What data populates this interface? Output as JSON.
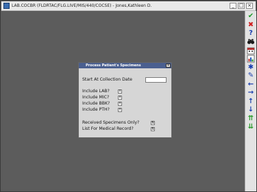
{
  "window": {
    "title": "LAB.COCBR (FLDRTAC/FLG.LIVE/MIS/440/COCSE) - Jones,Kathleen D.",
    "minimize_glyph": "_",
    "maximize_glyph": "□",
    "close_glyph": "×"
  },
  "toolbar": {
    "items": [
      {
        "name": "ok-check-icon",
        "glyph": "✔",
        "color": "#1e9a28"
      },
      {
        "name": "cancel-x-icon",
        "glyph": "✖",
        "color": "#d02020"
      },
      {
        "name": "help-question-icon",
        "glyph": "?",
        "color": "#1a3fb0"
      },
      {
        "name": "binoculars-icon",
        "glyph": "",
        "color": "#1a1a1a"
      },
      {
        "name": "calendar-icon",
        "glyph": "",
        "color": "#b03030"
      },
      {
        "name": "report-chart-icon",
        "glyph": "",
        "color": "#c03030"
      },
      {
        "name": "star-icon",
        "glyph": "✱",
        "color": "#1a3fb0"
      },
      {
        "name": "edit-pencil-icon",
        "glyph": "✎",
        "color": "#1a3fb0"
      },
      {
        "name": "arrow-left-icon",
        "glyph": "←",
        "color": "#1a3fb0"
      },
      {
        "name": "arrow-right-icon",
        "glyph": "→",
        "color": "#1a3fb0"
      },
      {
        "name": "arrow-up-icon",
        "glyph": "↑",
        "color": "#1a3fb0"
      },
      {
        "name": "arrow-down-icon",
        "glyph": "↓",
        "color": "#1a3fb0"
      },
      {
        "name": "page-up-icon",
        "glyph": "⇈",
        "color": "#2a9a2a"
      },
      {
        "name": "page-down-icon",
        "glyph": "⇊",
        "color": "#2a9a2a"
      }
    ]
  },
  "dialog": {
    "title": "Process Patient's Specimens",
    "close_glyph": "×",
    "start_label": "Start At Collection Date",
    "start_value": "",
    "include_lab_label": "Include LAB?",
    "include_lab_value": "Y",
    "include_mic_label": "Include MIC?",
    "include_mic_value": "Y",
    "include_bbk_label": "Include BBK?",
    "include_bbk_value": "Y",
    "include_pth_label": "Include PTH?",
    "include_pth_value": "Y",
    "received_only_label": "Received Specimens Only?",
    "received_only_value": "N",
    "medical_record_label": "List For Medical Record?",
    "medical_record_value": "N"
  }
}
